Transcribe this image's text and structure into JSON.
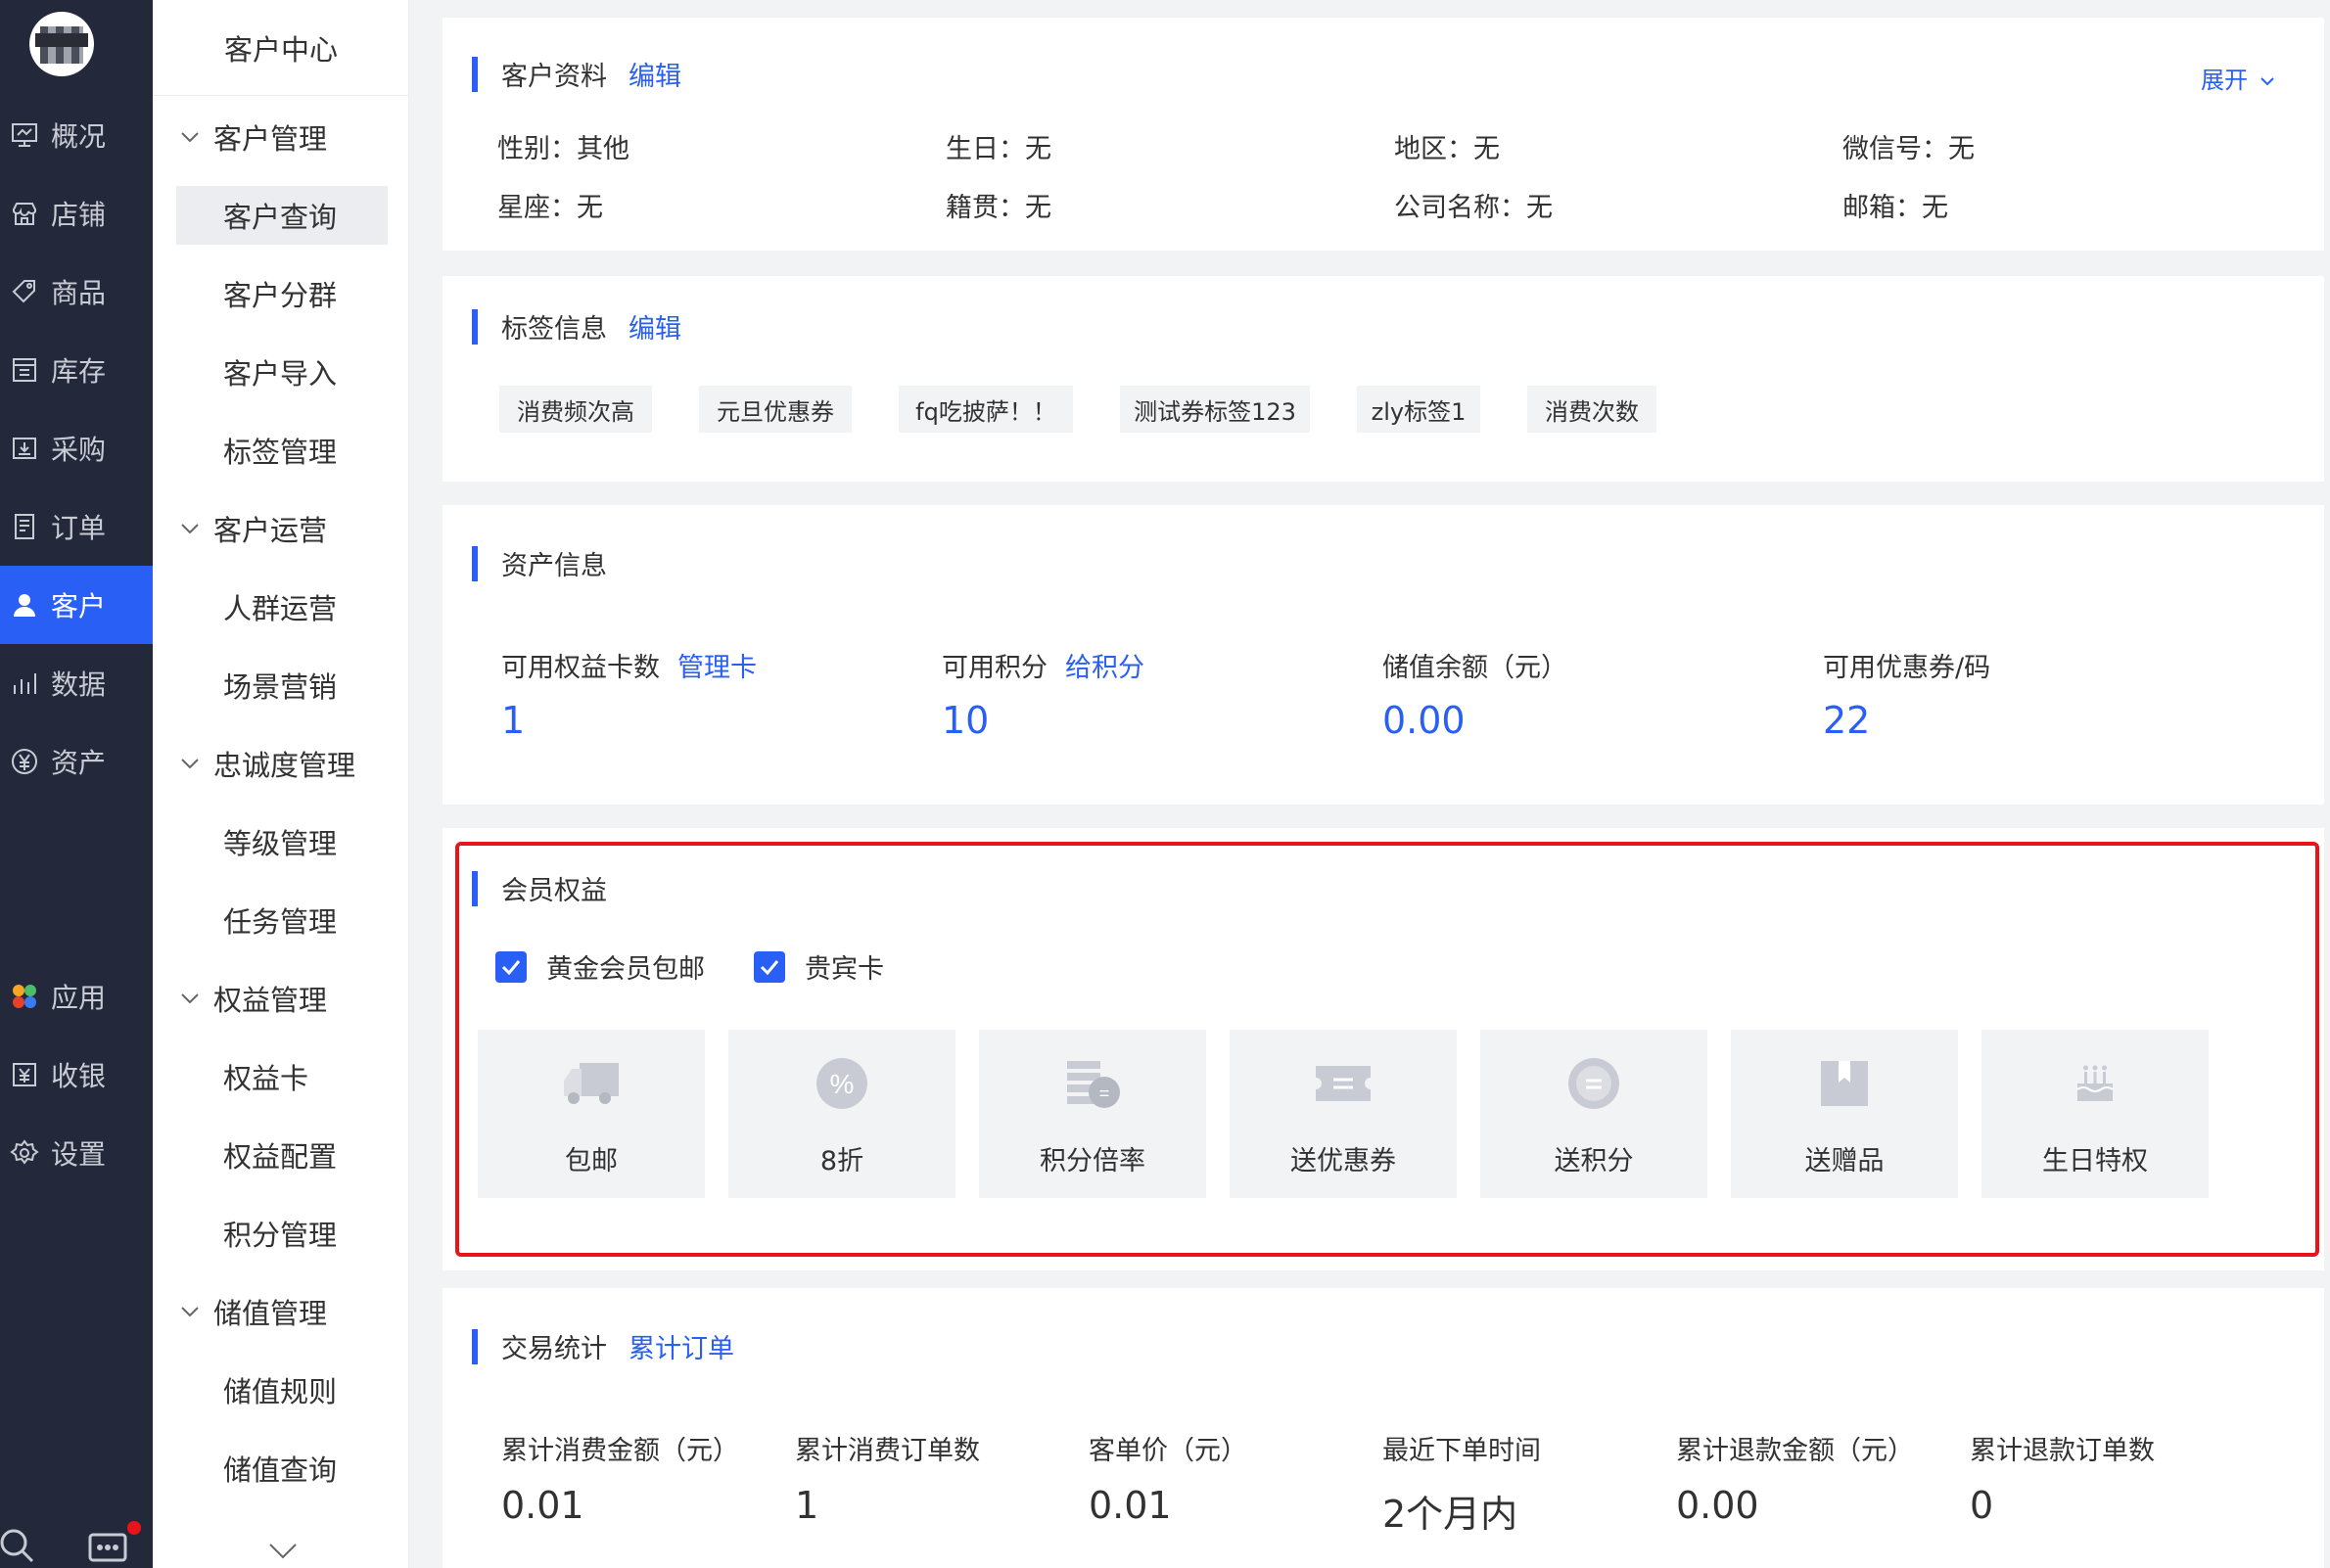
{
  "nav": {
    "items": [
      {
        "label": "概况",
        "icon": "overview-icon"
      },
      {
        "label": "店铺",
        "icon": "store-icon"
      },
      {
        "label": "商品",
        "icon": "tag-icon"
      },
      {
        "label": "库存",
        "icon": "inventory-icon"
      },
      {
        "label": "采购",
        "icon": "purchase-icon"
      },
      {
        "label": "订单",
        "icon": "order-icon"
      },
      {
        "label": "客户",
        "icon": "customer-icon",
        "active": true
      },
      {
        "label": "数据",
        "icon": "chart-icon"
      },
      {
        "label": "资产",
        "icon": "yuan-icon"
      },
      {
        "label": "应用",
        "icon": "apps-icon"
      },
      {
        "label": "收银",
        "icon": "cashier-icon"
      },
      {
        "label": "设置",
        "icon": "settings-icon"
      }
    ]
  },
  "sidebar": {
    "title": "客户中心",
    "groups": [
      {
        "label": "客户管理",
        "items": [
          "客户查询",
          "客户分群",
          "客户导入",
          "标签管理"
        ]
      },
      {
        "label": "客户运营",
        "items": [
          "人群运营",
          "场景营销"
        ]
      },
      {
        "label": "忠诚度管理",
        "items": [
          "等级管理",
          "任务管理"
        ]
      },
      {
        "label": "权益管理",
        "items": [
          "权益卡",
          "权益配置",
          "积分管理"
        ]
      },
      {
        "label": "储值管理",
        "items": [
          "储值规则",
          "储值查询"
        ]
      }
    ],
    "selected": "客户查询"
  },
  "profile": {
    "title": "客户资料",
    "edit": "编辑",
    "expand": "展开",
    "fields": [
      "性别：其他",
      "生日：无",
      "地区：无",
      "微信号：无",
      "星座：无",
      "籍贯：无",
      "公司名称：无",
      "邮箱：无"
    ]
  },
  "tags": {
    "title": "标签信息",
    "edit": "编辑",
    "items": [
      "消费频次高",
      "元旦优惠券",
      "fq吃披萨！！",
      "测试券标签123",
      "zly标签1",
      "消费次数"
    ]
  },
  "assets": {
    "title": "资产信息",
    "items": [
      {
        "label": "可用权益卡数",
        "link": "管理卡",
        "value": "1"
      },
      {
        "label": "可用积分",
        "link": "给积分",
        "value": "10"
      },
      {
        "label": "储值余额（元）",
        "link": "",
        "value": "0.00"
      },
      {
        "label": "可用优惠券/码",
        "link": "",
        "value": "22"
      }
    ]
  },
  "benefits": {
    "title": "会员权益",
    "cards": [
      {
        "label": "黄金会员包邮",
        "checked": true
      },
      {
        "label": "贵宾卡",
        "checked": true
      }
    ],
    "tiles": [
      {
        "label": "包邮",
        "icon": "truck-icon"
      },
      {
        "label": "8折",
        "icon": "percent-icon"
      },
      {
        "label": "积分倍率",
        "icon": "points-multiplier-icon"
      },
      {
        "label": "送优惠券",
        "icon": "coupon-icon"
      },
      {
        "label": "送积分",
        "icon": "points-icon"
      },
      {
        "label": "送赠品",
        "icon": "gift-icon"
      },
      {
        "label": "生日特权",
        "icon": "cake-icon"
      }
    ]
  },
  "transactions": {
    "title": "交易统计",
    "link": "累计订单",
    "items": [
      {
        "label": "累计消费金额（元）",
        "value": "0.01"
      },
      {
        "label": "累计消费订单数",
        "value": "1"
      },
      {
        "label": "客单价（元）",
        "value": "0.01"
      },
      {
        "label": "最近下单时间",
        "value": "2个月内"
      },
      {
        "label": "累计退款金额（元）",
        "value": "0.00"
      },
      {
        "label": "累计退款订单数",
        "value": "0"
      }
    ]
  },
  "colors": {
    "accent": "#2a5ff5",
    "nav_bg": "#23283a",
    "highlight": "#e8141a"
  }
}
